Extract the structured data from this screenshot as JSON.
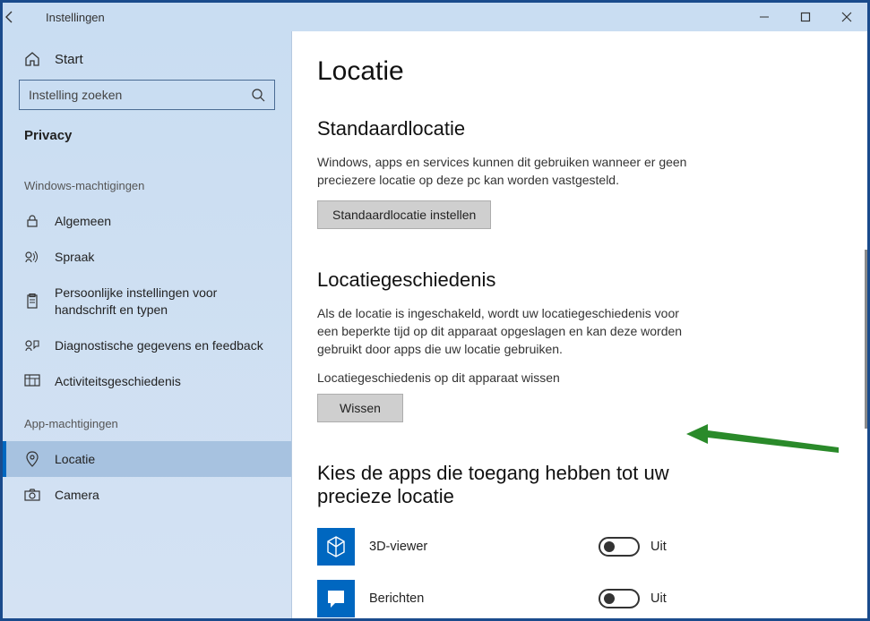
{
  "titlebar": {
    "title": "Instellingen"
  },
  "sidebar": {
    "home": "Start",
    "search_placeholder": "Instelling zoeken",
    "category": "Privacy",
    "section1": "Windows-machtigingen",
    "items1": [
      {
        "label": "Algemeen"
      },
      {
        "label": "Spraak"
      },
      {
        "label": "Persoonlijke instellingen voor handschrift en typen"
      },
      {
        "label": "Diagnostische gegevens en feedback"
      },
      {
        "label": "Activiteitsgeschiedenis"
      }
    ],
    "section2": "App-machtigingen",
    "items2": [
      {
        "label": "Locatie"
      },
      {
        "label": "Camera"
      }
    ]
  },
  "main": {
    "title": "Locatie",
    "section1": {
      "heading": "Standaardlocatie",
      "desc": "Windows, apps en services kunnen dit gebruiken wanneer er geen preciezere locatie op deze pc kan worden vastgesteld.",
      "button": "Standaardlocatie instellen"
    },
    "section2": {
      "heading": "Locatiegeschiedenis",
      "desc": "Als de locatie is ingeschakeld, wordt uw locatiegeschiedenis voor een beperkte tijd op dit apparaat opgeslagen en kan deze worden gebruikt door apps die uw locatie gebruiken.",
      "sublabel": "Locatiegeschiedenis op dit apparaat wissen",
      "button": "Wissen"
    },
    "section3": {
      "heading": "Kies de apps die toegang hebben tot uw precieze locatie",
      "apps": [
        {
          "name": "3D-viewer",
          "state": "Uit"
        },
        {
          "name": "Berichten",
          "state": "Uit"
        }
      ]
    }
  }
}
